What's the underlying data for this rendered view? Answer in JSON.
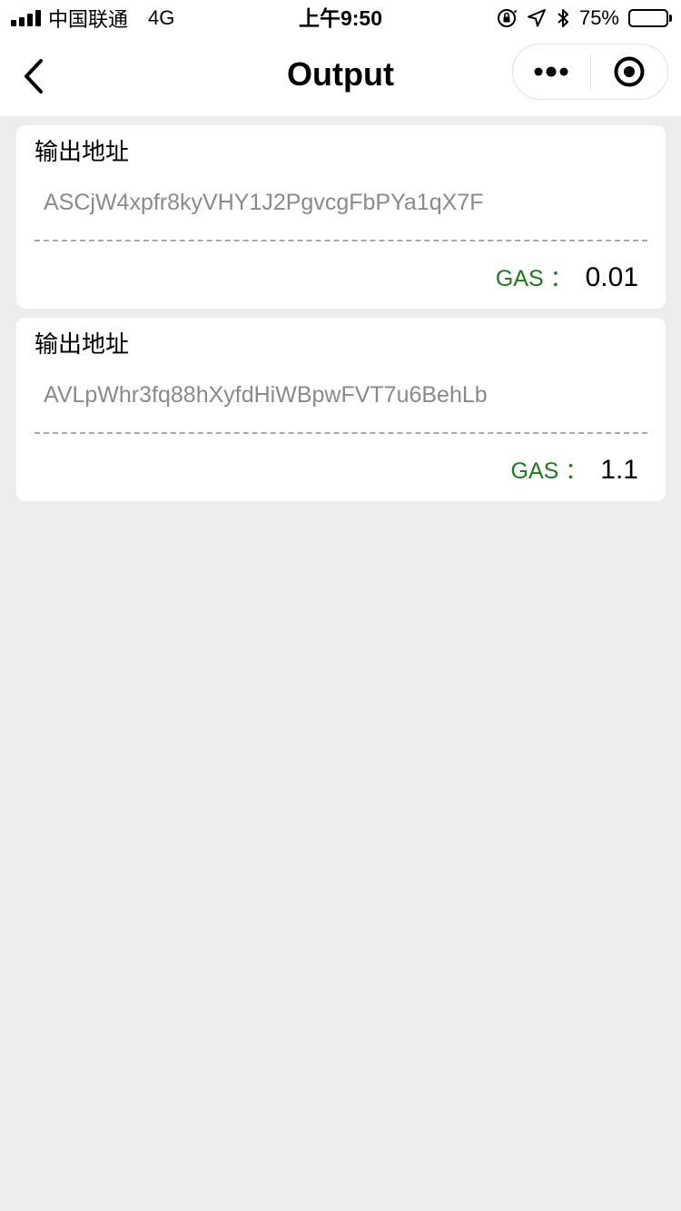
{
  "status_bar": {
    "carrier": "中国联通",
    "network": "4G",
    "time": "上午9:50",
    "battery": "75%",
    "battery_level": 0.75
  },
  "nav": {
    "title": "Output"
  },
  "outputs": [
    {
      "title": "输出地址",
      "address": "ASCjW4xpfr8kyVHY1J2PgvcgFbPYa1qX7F",
      "gas_label": "GAS ：",
      "gas_value": "0.01"
    },
    {
      "title": "输出地址",
      "address": "AVLpWhr3fq88hXyfdHiWBpwFVT7u6BehLb",
      "gas_label": "GAS ：",
      "gas_value": "1.1"
    }
  ],
  "colors": {
    "background": "#ededed",
    "gas_label": "#1f7a1f",
    "address_text": "#8a8a8a"
  },
  "icons": [
    "signal-icon",
    "screen-lock-icon",
    "location-arrow-icon",
    "bluetooth-icon",
    "battery-icon",
    "back-chevron-icon",
    "more-dots-icon",
    "record-target-icon"
  ]
}
